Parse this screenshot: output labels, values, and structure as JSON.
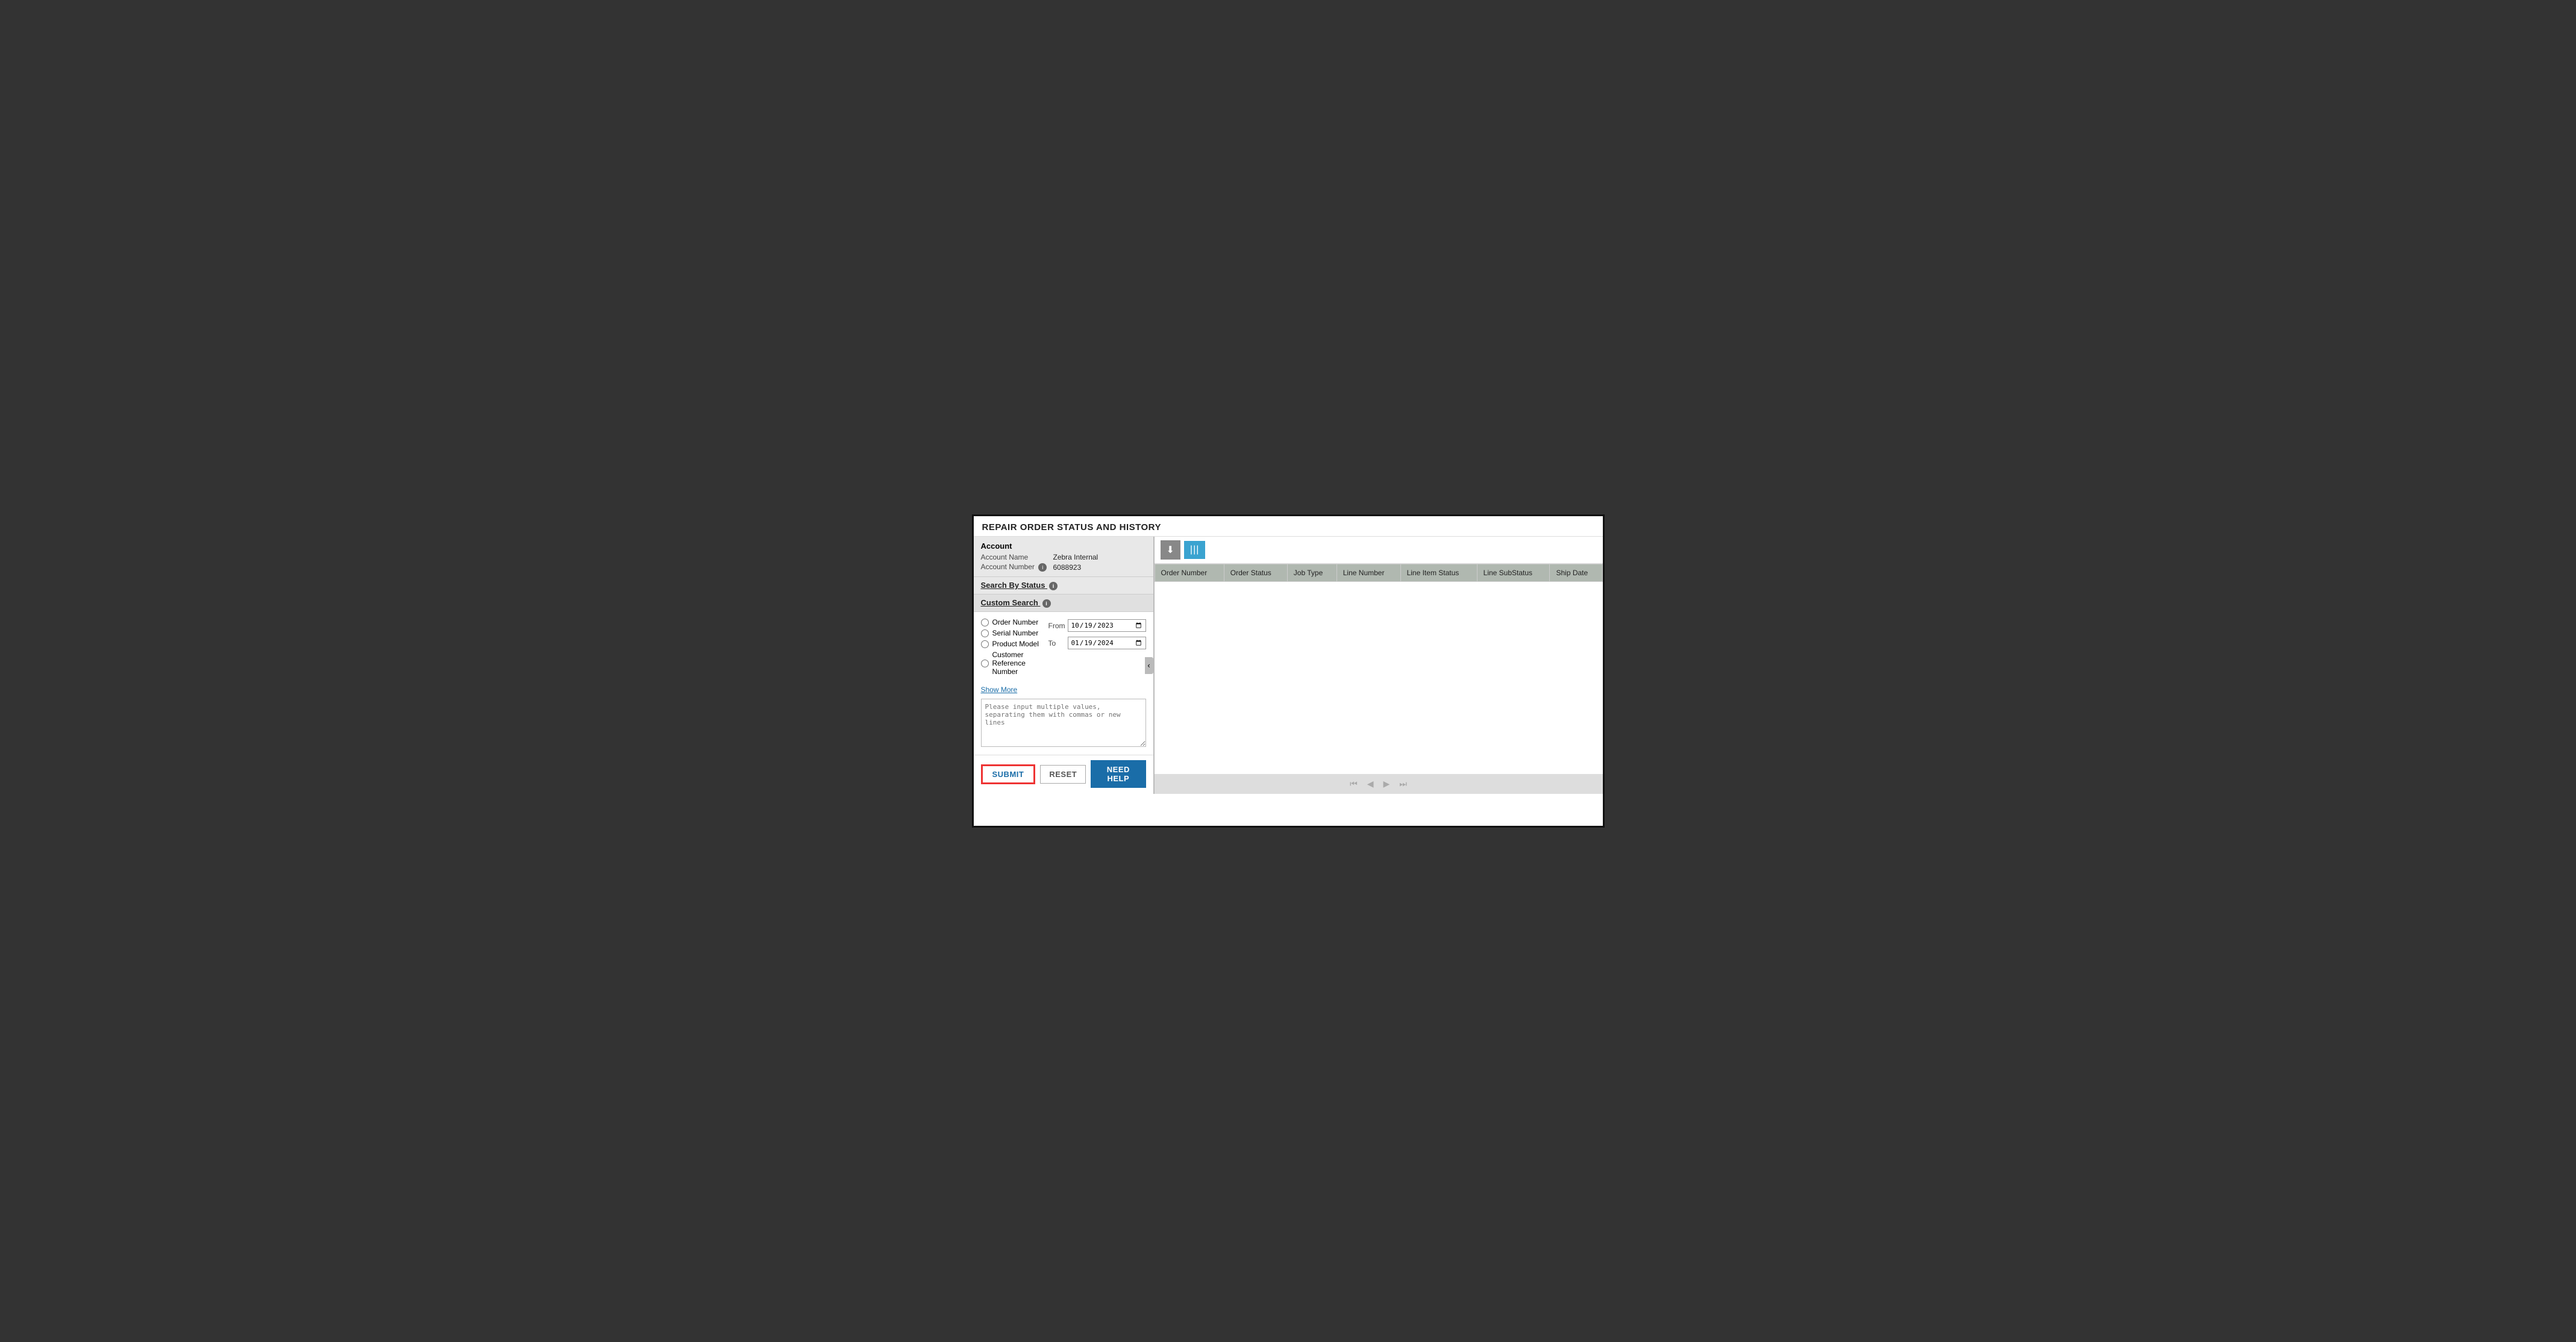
{
  "page": {
    "title": "REPAIR ORDER STATUS AND HISTORY"
  },
  "left": {
    "account": {
      "section_title": "Account",
      "name_label": "Account Name",
      "name_value": "Zebra Internal",
      "number_label": "Account Number",
      "number_value": "6088923"
    },
    "search_by_status_label": "Search By Status",
    "custom_search_label": "Custom Search",
    "radio_options": [
      {
        "id": "radio-order",
        "label": "Order Number"
      },
      {
        "id": "radio-serial",
        "label": "Serial Number"
      },
      {
        "id": "radio-model",
        "label": "Product Model"
      },
      {
        "id": "radio-ref",
        "label": "Customer Reference Number"
      }
    ],
    "date_range": {
      "from_label": "From",
      "to_label": "To",
      "from_value": "2023-10-19",
      "to_value": "2024-01-19",
      "from_display": "10/19/2023",
      "to_display": "01/19/2024"
    },
    "show_more_label": "Show More",
    "textarea_placeholder": "Please input multiple values, separating them with commas or new lines",
    "buttons": {
      "submit": "SUBMIT",
      "reset": "RESET",
      "need_help": "NEED HELP"
    }
  },
  "right": {
    "toolbar": {
      "download_icon": "⬇",
      "columns_icon": "|||"
    },
    "table": {
      "columns": [
        "Order Number",
        "Order Status",
        "Job Type",
        "Line Number",
        "Line Item Status",
        "Line SubStatus",
        "Ship Date"
      ],
      "rows": []
    },
    "pagination": {
      "first": "⏮",
      "prev": "◀",
      "next": "▶",
      "last": "⏭"
    }
  }
}
